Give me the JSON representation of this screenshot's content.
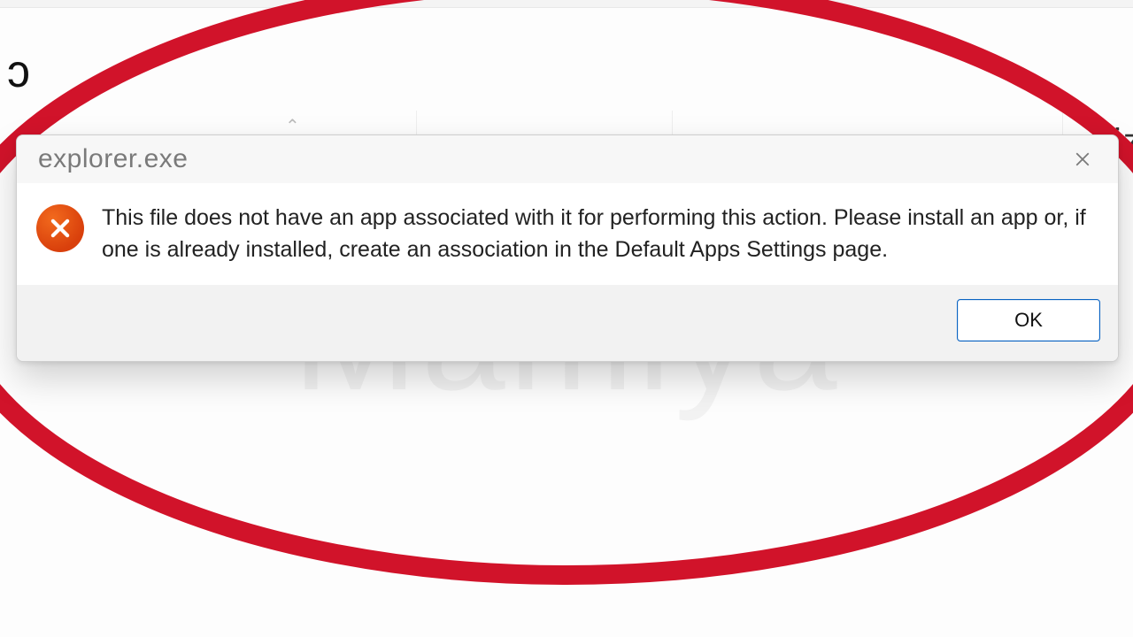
{
  "background": {
    "glyph": "ɔ",
    "right_fragment": "ize",
    "sort_indicator": "⌃"
  },
  "watermark": "Mamiya",
  "dialog": {
    "title": "explorer.exe",
    "message": "This file does not have an app associated with it for performing this action. Please install an app or, if one is already installed, create an association in the Default Apps Settings page.",
    "ok_label": "OK"
  }
}
